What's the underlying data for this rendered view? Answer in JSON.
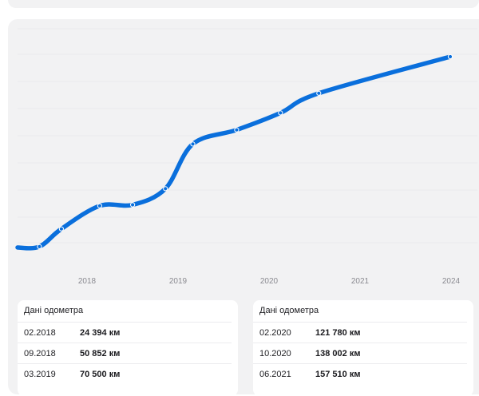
{
  "colors": {
    "line": "#0a6fdc",
    "panel": "#f2f2f3",
    "grid": "#e3e3e6",
    "tick_text": "#8a8a90"
  },
  "chart_data": {
    "type": "line",
    "title": "",
    "xlabel": "",
    "ylabel": "",
    "grid": true,
    "x_ticks": [
      "2018",
      "2019",
      "2020",
      "2021",
      "2024"
    ],
    "x_range": [
      "2017-06",
      "2024-01"
    ],
    "ylim": [
      0,
      340000
    ],
    "series": [
      {
        "points": [
          {
            "date": "2017-06",
            "km": 3000
          },
          {
            "date": "2017-10",
            "km": 4000
          },
          {
            "date": "2018-02",
            "km": 24394
          },
          {
            "date": "2018-09",
            "km": 50852
          },
          {
            "date": "2019-03",
            "km": 52000
          },
          {
            "date": "2019-09",
            "km": 70500
          },
          {
            "date": "2020-02",
            "km": 121780
          },
          {
            "date": "2020-10",
            "km": 138002
          },
          {
            "date": "2021-06",
            "km": 157510
          },
          {
            "date": "2022-01",
            "km": 180000
          },
          {
            "date": "2024-01",
            "km": 222000
          }
        ]
      }
    ]
  },
  "odometer_left": {
    "title": "Дані одометра",
    "rows": [
      {
        "date": "02.2018",
        "km": "24 394 км"
      },
      {
        "date": "09.2018",
        "km": "50 852 км"
      },
      {
        "date": "03.2019",
        "km": "70 500 км"
      }
    ]
  },
  "odometer_right": {
    "title": "Дані одометра",
    "rows": [
      {
        "date": "02.2020",
        "km": "121 780 км"
      },
      {
        "date": "10.2020",
        "km": "138 002 км"
      },
      {
        "date": "06.2021",
        "km": "157 510 км"
      }
    ]
  }
}
